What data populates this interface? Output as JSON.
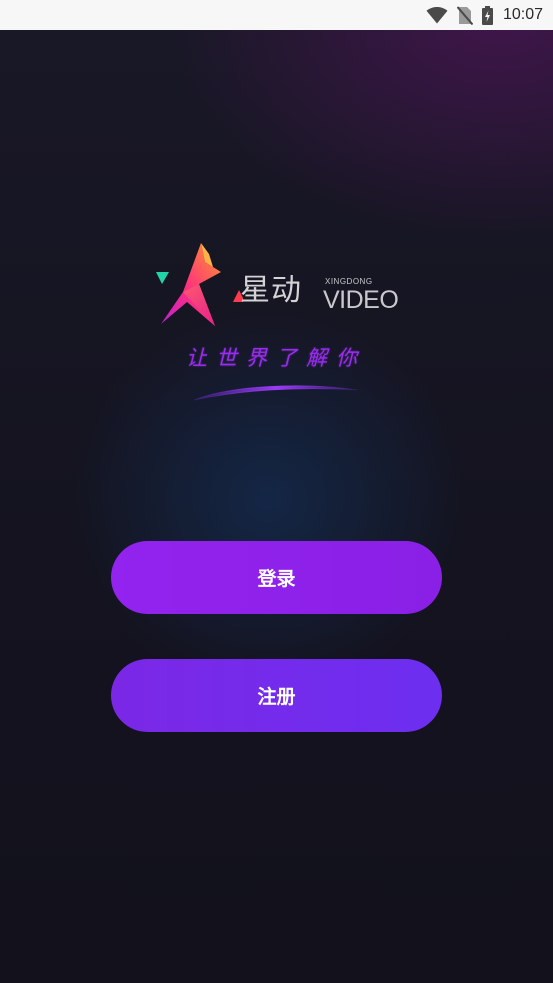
{
  "status_bar": {
    "time": "10:07",
    "icons": [
      "wifi-icon",
      "no-sim-icon",
      "battery-charging-icon"
    ]
  },
  "logo": {
    "name_cn": "星动",
    "name_pinyin": "XINGDONG",
    "name_en": "VIDEO"
  },
  "slogan": "让世界了解你",
  "buttons": {
    "login_label": "登录",
    "register_label": "注册"
  },
  "colors": {
    "background": "#14131f",
    "status_bar": "#f7f7f7",
    "accent_purple": "#8a1fe6",
    "register_purple": "#6d2ef0",
    "slogan_purple": "#9a2cf0"
  }
}
